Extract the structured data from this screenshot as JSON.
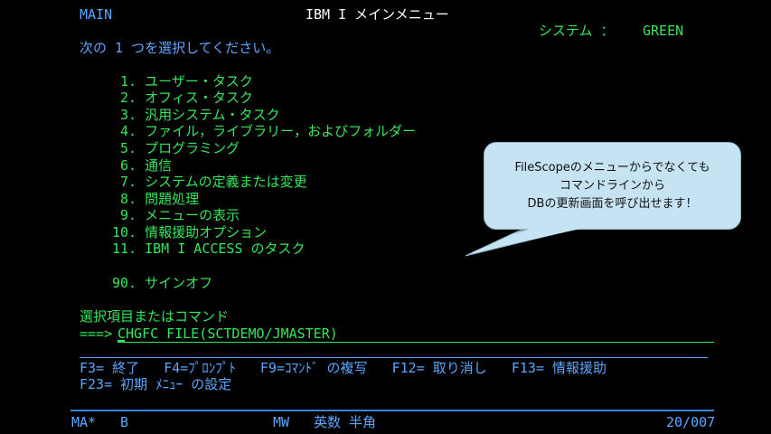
{
  "header": {
    "screen_id": "MAIN",
    "title": "IBM I メインメニュー",
    "system_label": "システム ：",
    "system_name": "GREEN"
  },
  "prompt": "次の 1 つを選択してください。",
  "menu": {
    "items": [
      {
        "number": " 1.",
        "label": "ユーザー・タスク"
      },
      {
        "number": " 2.",
        "label": "オフィス・タスク"
      },
      {
        "number": " 3.",
        "label": "汎用システム・タスク"
      },
      {
        "number": " 4.",
        "label": "ファイル，ライブラリー，およびフォルダー"
      },
      {
        "number": " 5.",
        "label": "プログラミング"
      },
      {
        "number": " 6.",
        "label": "通信"
      },
      {
        "number": " 7.",
        "label": "システムの定義または変更"
      },
      {
        "number": " 8.",
        "label": "問題処理"
      },
      {
        "number": " 9.",
        "label": "メニューの表示"
      },
      {
        "number": "10.",
        "label": "情報援助オプション"
      },
      {
        "number": "11.",
        "label": "IBM I ACCESS のタスク"
      },
      {
        "number": "90.",
        "label": "サインオフ"
      }
    ]
  },
  "command": {
    "label": "選択項目またはコマンド",
    "arrow": "===>",
    "value": "CHGFC FILE(SCTDEMO/JMASTER)"
  },
  "function_keys": {
    "line1": "F3= 終了   F4=ﾌﾟﾛﾝﾌﾟﾄ   F9=ｺﾏﾝﾄﾞ の複写   F12= 取り消し   F13= 情報援助",
    "line2": "F23= 初期 ﾒﾆｭｰ の設定"
  },
  "status_bar": {
    "left": "MA*",
    "session": "B",
    "mode": "MW",
    "input_mode": "英数 半角",
    "cursor_pos": "20/007"
  },
  "callout": {
    "text": "FileScopeのメニューからでなくても\nコマンドラインから\nDBの更新画面を呼び出せます！",
    "background": "#c5e3f3"
  },
  "colors": {
    "green": "#34e65c",
    "blue": "#5aa6ff",
    "white": "#ffffff",
    "background": "#000000"
  }
}
